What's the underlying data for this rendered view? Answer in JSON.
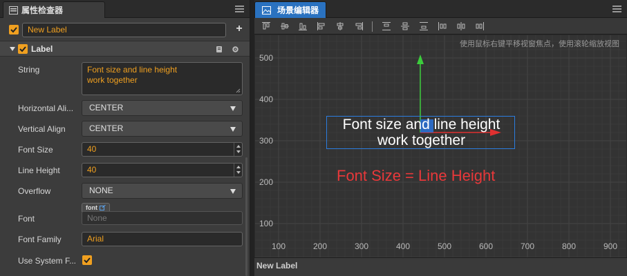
{
  "inspector": {
    "title": "属性检查器",
    "node": {
      "enabled": true,
      "name": "New Label"
    },
    "component": {
      "title": "Label",
      "enabled": true
    },
    "properties": {
      "string_label": "String",
      "string_lines": [
        "Font size and line height",
        "work together"
      ],
      "horizontal_align_label": "Horizontal Ali...",
      "horizontal_align_value": "CENTER",
      "vertical_align_label": "Vertical Align",
      "vertical_align_value": "CENTER",
      "font_size_label": "Font Size",
      "font_size_value": "40",
      "line_height_label": "Line Height",
      "line_height_value": "40",
      "overflow_label": "Overflow",
      "overflow_value": "NONE",
      "font_label": "Font",
      "font_tag": "font",
      "font_placeholder": "None",
      "font_family_label": "Font Family",
      "font_family_value": "Arial",
      "use_system_font_label": "Use System F...",
      "use_system_font_checked": true
    }
  },
  "scene": {
    "title": "场景编辑器",
    "hint": "使用鼠标右键平移视窗焦点，使用滚轮缩放视图",
    "y_ticks": [
      "500",
      "400",
      "300",
      "200",
      "100"
    ],
    "x_ticks": [
      "100",
      "200",
      "300",
      "400",
      "500",
      "600",
      "700",
      "800",
      "900"
    ],
    "label_lines": [
      "Font size and line height",
      "work together"
    ],
    "annotation": "Font Size = Line Height",
    "status": "New Label",
    "colors": {
      "accent": "#f0a020",
      "selection": "#2b7de0",
      "annotation": "#e8383a",
      "tab_active": "#2a72c0"
    }
  }
}
